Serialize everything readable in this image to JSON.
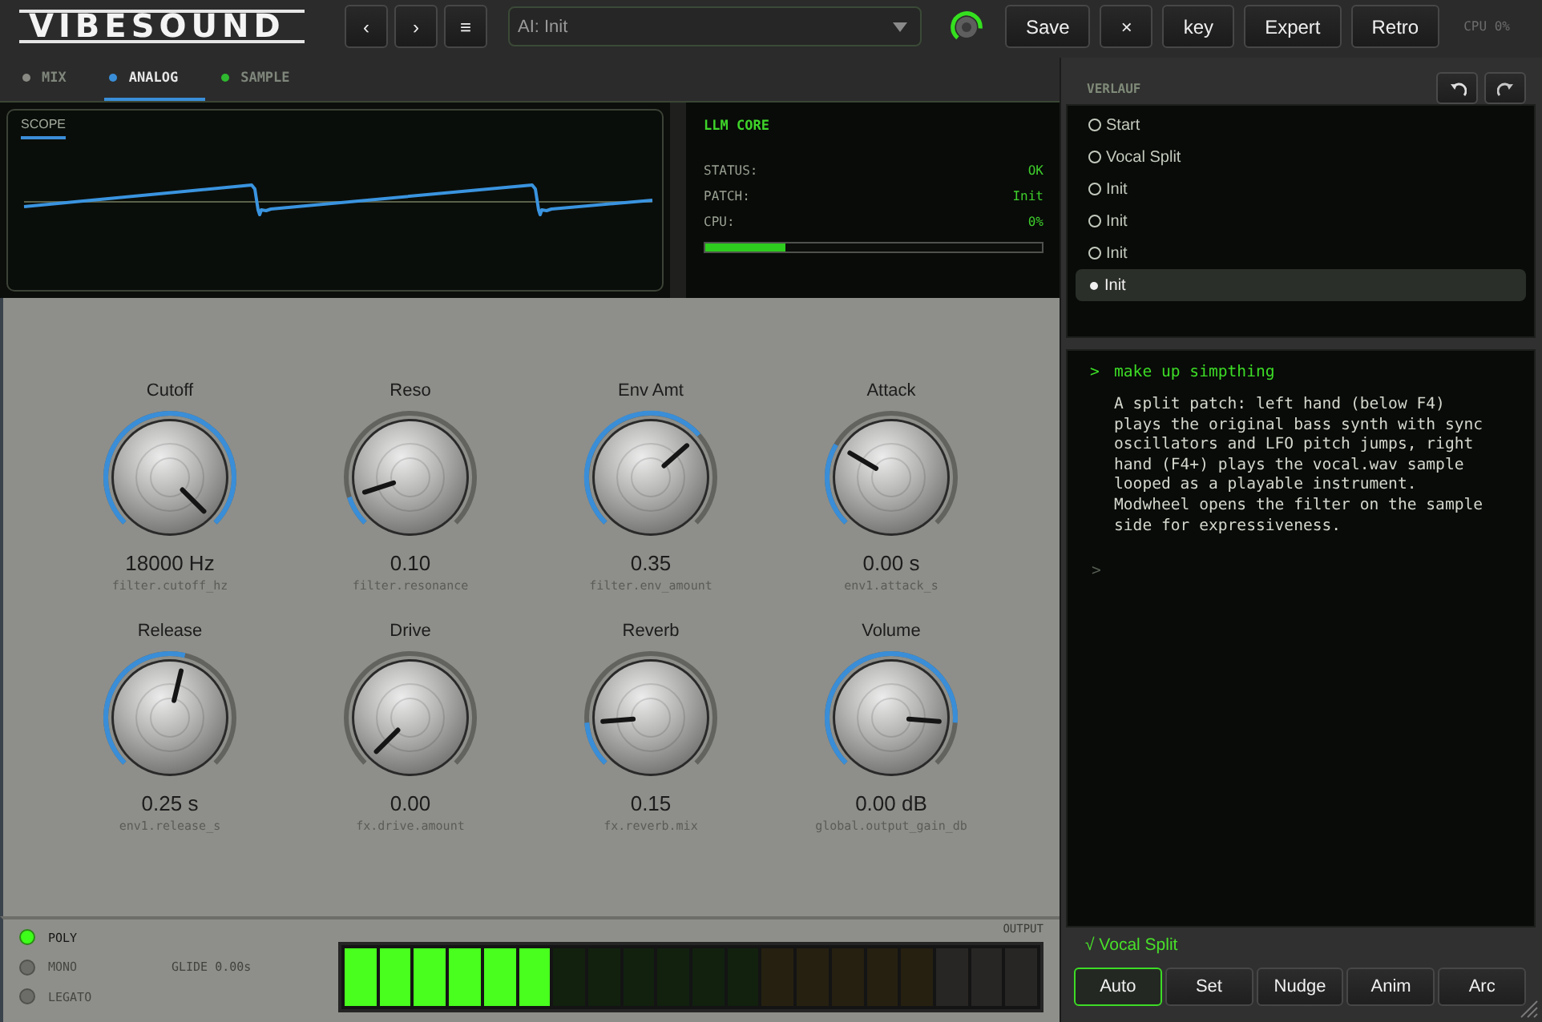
{
  "header": {
    "logo": "VIBESOUND",
    "nav_buttons": [
      "‹",
      "›",
      "≡"
    ],
    "preset_dropdown": {
      "value": "AI: Init"
    },
    "buttons": [
      "Save",
      "×",
      "key",
      "Expert",
      "Retro"
    ],
    "cpu": "CPU 0%"
  },
  "tabs": [
    {
      "label": "MIX",
      "color": "#8a8a84",
      "selected": false
    },
    {
      "label": "ANALOG",
      "color": "#3a8ed8",
      "selected": true
    },
    {
      "label": "SAMPLE",
      "color": "#2fb82f",
      "selected": false
    }
  ],
  "scope": {
    "title": "SCOPE"
  },
  "llm_core": {
    "title": "LLM CORE",
    "rows": [
      {
        "label": "STATUS:",
        "value": "OK"
      },
      {
        "label": "PATCH:",
        "value": "Init"
      },
      {
        "label": "CPU:",
        "value": "0%"
      }
    ],
    "cpu_bar": {
      "level": 0.24
    }
  },
  "knobs": [
    {
      "label": "Cutoff",
      "value": "18000 Hz",
      "param": "filter.cutoff_hz",
      "level": 1
    },
    {
      "label": "Reso",
      "value": "0.10",
      "param": "filter.resonance",
      "level": 0.1
    },
    {
      "label": "Env Amt",
      "value": "0.35",
      "param": "filter.env_amount",
      "level": 0.68
    },
    {
      "label": "Attack",
      "value": "0.00 s",
      "param": "env1.attack_s",
      "level": 0.28
    },
    {
      "label": "Release",
      "value": "0.25 s",
      "param": "env1.release_s",
      "level": 0.55
    },
    {
      "label": "Drive",
      "value": "0.00",
      "param": "fx.drive.amount",
      "level": 0
    },
    {
      "label": "Reverb",
      "value": "0.15",
      "param": "fx.reverb.mix",
      "level": 0.15
    },
    {
      "label": "Volume",
      "value": "0.00 dB",
      "param": "global.output_gain_db",
      "level": 0.85
    }
  ],
  "voice_modes": [
    {
      "label": "POLY",
      "selected": true
    },
    {
      "label": "MONO",
      "selected": false
    },
    {
      "label": "LEGATO",
      "selected": false
    }
  ],
  "glide": "GLIDE 0.00s",
  "output_meter": {
    "label": "OUTPUT",
    "level": 0.3
  },
  "history": {
    "title": "VERLAUF",
    "items": [
      {
        "label": "Start",
        "selected": false
      },
      {
        "label": "Vocal Split",
        "selected": false
      },
      {
        "label": "Init",
        "selected": false
      },
      {
        "label": "Init",
        "selected": false
      },
      {
        "label": "Init",
        "selected": false
      },
      {
        "label": "Init",
        "selected": true
      }
    ]
  },
  "chat": {
    "prompt_marker": ">",
    "prompt": "make up simpthing",
    "response": "A split patch: left hand (below F4) plays the original bass synth with sync oscillators and LFO pitch jumps, right hand (F4+) plays the vocal.wav sample looped as a playable instrument. Modwheel opens the filter on the sample side for expressiveness.",
    "input_marker": ">"
  },
  "status": "√ Vocal Split",
  "modes": [
    {
      "label": "Auto",
      "selected": true
    },
    {
      "label": "Set",
      "selected": false
    },
    {
      "label": "Nudge",
      "selected": false
    },
    {
      "label": "Anim",
      "selected": false
    },
    {
      "label": "Arc",
      "selected": false
    }
  ]
}
